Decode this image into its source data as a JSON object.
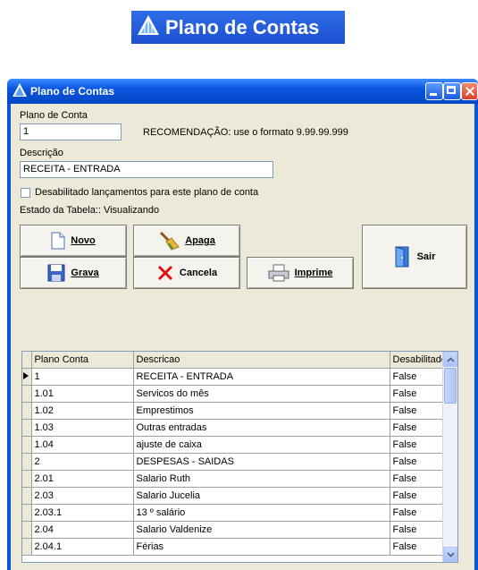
{
  "banner": {
    "title": "Plano de Contas"
  },
  "window": {
    "title": "Plano de Contas"
  },
  "form": {
    "plano_label": "Plano de Conta",
    "plano_value": "1",
    "recomendacao": "RECOMENDAÇÃO: use o formato 9.99.99.999",
    "descricao_label": "Descrição",
    "descricao_value": "RECEITA - ENTRADA",
    "desabilitado_label": "Desabilitado lançamentos para este plano de conta",
    "estado": "Estado da Tabela:: Visualizando"
  },
  "buttons": {
    "novo": "Novo",
    "apaga": "Apaga",
    "grava": "Grava",
    "cancela": "Cancela",
    "imprime": "Imprime",
    "sair": "Sair"
  },
  "grid": {
    "headers": [
      "Plano Conta",
      "Descricao",
      "Desabilitado"
    ],
    "rows": [
      [
        "1",
        "RECEITA - ENTRADA",
        "False"
      ],
      [
        "1.01",
        "Servicos do mês",
        "False"
      ],
      [
        "1.02",
        "Emprestimos",
        "False"
      ],
      [
        "1.03",
        "Outras entradas",
        "False"
      ],
      [
        "1.04",
        "ajuste de caixa",
        "False"
      ],
      [
        "2",
        "DESPESAS - SAIDAS",
        "False"
      ],
      [
        "2.01",
        "Salario Ruth",
        "False"
      ],
      [
        "2.03",
        "Salario Jucelia",
        "False"
      ],
      [
        "2.03.1",
        "13 º salário",
        "False"
      ],
      [
        "2.04",
        "Salario Valdenize",
        "False"
      ],
      [
        "2.04.1",
        "Férias",
        "False"
      ]
    ]
  }
}
